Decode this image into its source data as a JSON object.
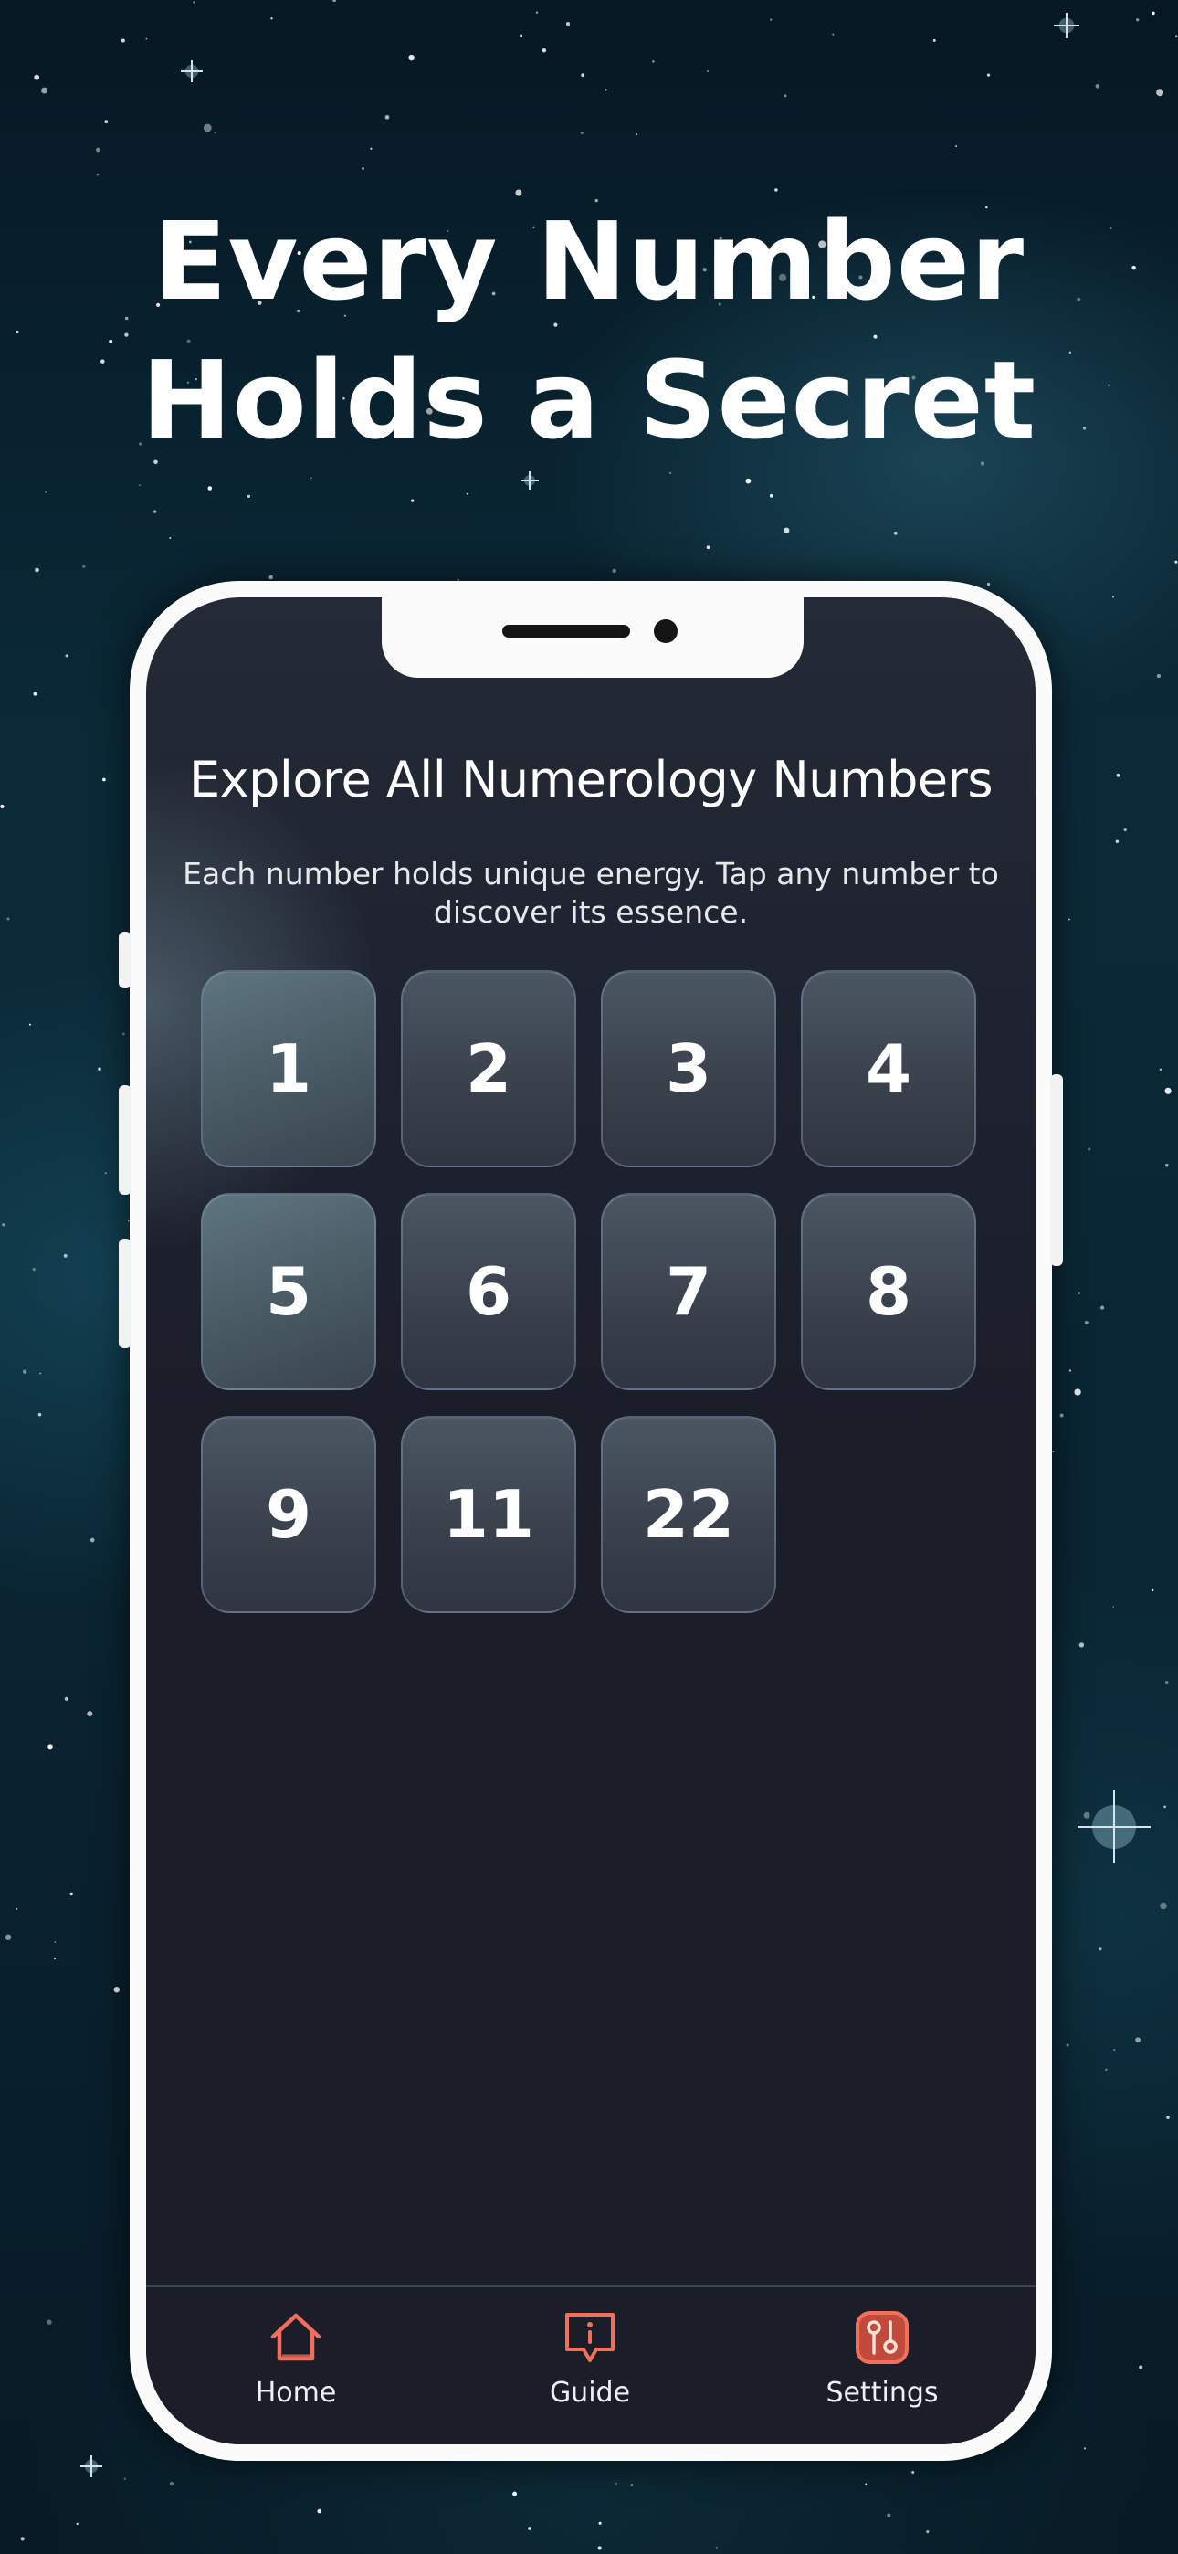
{
  "promo": {
    "headline_line1": "Every Number",
    "headline_line2": "Holds a Secret"
  },
  "screen": {
    "title": "Explore All Numerology Numbers",
    "subtitle": "Each number holds unique energy. Tap any number to discover its essence.",
    "numbers": [
      "1",
      "2",
      "3",
      "4",
      "5",
      "6",
      "7",
      "8",
      "9",
      "11",
      "22"
    ]
  },
  "tabbar": {
    "tabs": [
      {
        "label": "Home",
        "icon": "home-icon"
      },
      {
        "label": "Guide",
        "icon": "guide-icon"
      },
      {
        "label": "Settings",
        "icon": "settings-icon"
      }
    ]
  },
  "colors": {
    "accent": "#f2705a",
    "screen_bg": "#1b1d29",
    "sky_bg": "#0b2a38"
  }
}
